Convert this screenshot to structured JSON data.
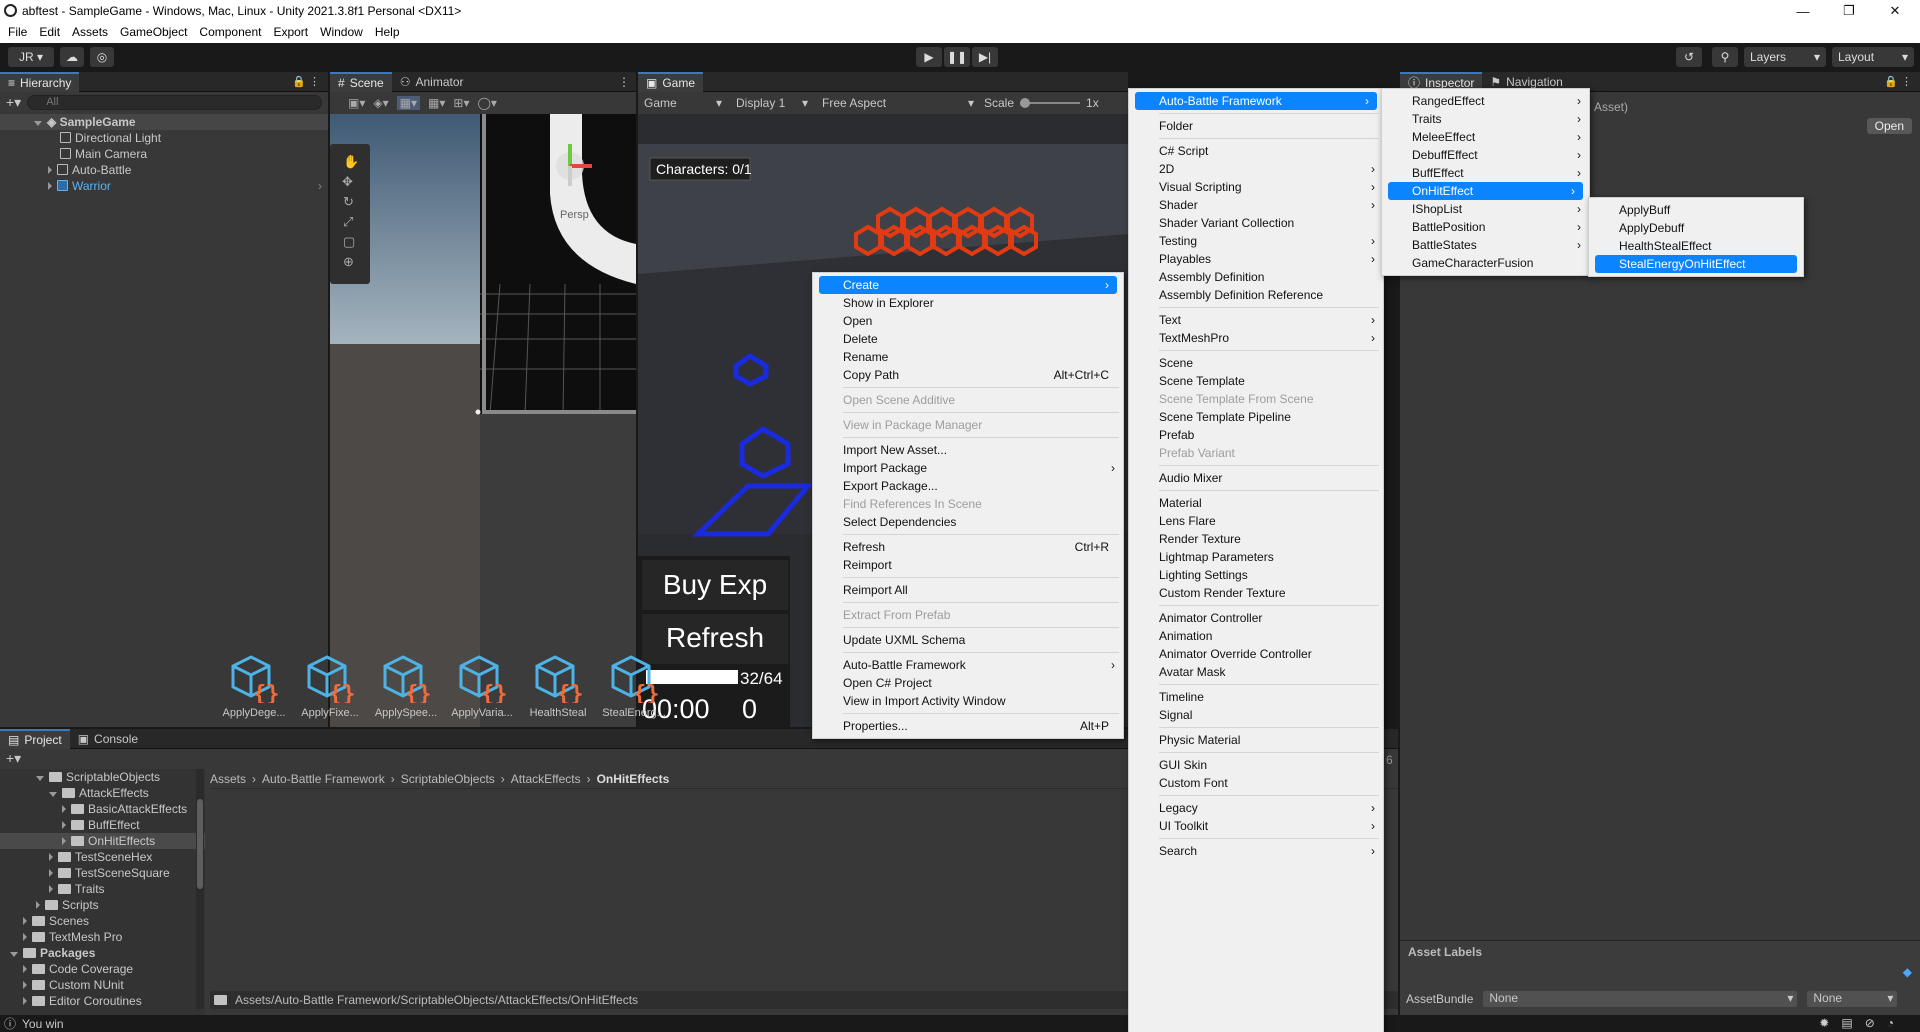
{
  "window": {
    "title": "abftest - SampleGame - Windows, Mac, Linux - Unity 2021.3.8f1 Personal <DX11>",
    "minimize": "—",
    "maximize": "❐",
    "close": "✕"
  },
  "menubar": [
    "File",
    "Edit",
    "Assets",
    "GameObject",
    "Component",
    "Export",
    "Window",
    "Help"
  ],
  "toolbar": {
    "account": "JR ▾",
    "layers": "Layers",
    "layout": "Layout"
  },
  "hierarchy": {
    "tab": "Hierarchy",
    "search_placeholder": "All",
    "scene": "SampleGame",
    "items": [
      "Directional Light",
      "Main Camera",
      "Auto-Battle",
      "Warrior"
    ]
  },
  "scene": {
    "tab_scene": "Scene",
    "tab_animator": "Animator",
    "persp_label": "Persp"
  },
  "game": {
    "tab": "Game",
    "display_mode": "Game",
    "display": "Display 1",
    "aspect": "Free Aspect",
    "scale_label": "Scale",
    "scale_value": "1x",
    "characters": "Characters: 0/1",
    "buy_exp": "Buy Exp",
    "refresh": "Refresh",
    "exp": "32/64",
    "timer": "00:00",
    "gold": "0"
  },
  "inspector": {
    "tab": "Inspector",
    "tab_nav": "Navigation",
    "asset_suffix": "Asset)",
    "open_button": "Open",
    "asset_labels": "Asset Labels",
    "asset_bundle": "AssetBundle",
    "bundle_value": "None",
    "variant_value": "None"
  },
  "project": {
    "tab_project": "Project",
    "tab_console": "Console",
    "tree": [
      {
        "label": "ScriptableObjects",
        "indent": 2,
        "open": true
      },
      {
        "label": "AttackEffects",
        "indent": 3,
        "open": true
      },
      {
        "label": "BasicAttackEffects",
        "indent": 4,
        "open": false
      },
      {
        "label": "BuffEffect",
        "indent": 4,
        "open": false
      },
      {
        "label": "OnHitEffects",
        "indent": 4,
        "open": false
      },
      {
        "label": "TestSceneHex",
        "indent": 3,
        "open": false
      },
      {
        "label": "TestSceneSquare",
        "indent": 3,
        "open": false
      },
      {
        "label": "Traits",
        "indent": 3,
        "open": false
      },
      {
        "label": "Scripts",
        "indent": 2,
        "open": false
      },
      {
        "label": "Scenes",
        "indent": 1,
        "open": false
      },
      {
        "label": "TextMesh Pro",
        "indent": 1,
        "open": false
      },
      {
        "label": "Packages",
        "indent": 0,
        "open": true
      },
      {
        "label": "Code Coverage",
        "indent": 1,
        "open": false
      },
      {
        "label": "Custom NUnit",
        "indent": 1,
        "open": false
      },
      {
        "label": "Editor Coroutines",
        "indent": 1,
        "open": false
      }
    ],
    "breadcrumb": [
      "Assets",
      "Auto-Battle Framework",
      "ScriptableObjects",
      "AttackEffects",
      "OnHitEffects"
    ],
    "assets": [
      "ApplyDege...",
      "ApplyFixe...",
      "ApplySpee...",
      "ApplyVaria...",
      "HealthSteal",
      "StealEnerg..."
    ],
    "path": "Assets/Auto-Battle Framework/ScriptableObjects/AttackEffects/OnHitEffects",
    "count": "6"
  },
  "status": {
    "text": "You win"
  },
  "context_menu": [
    {
      "label": "Create",
      "arrow": true,
      "selected": true
    },
    {
      "label": "Show in Explorer"
    },
    {
      "label": "Open"
    },
    {
      "label": "Delete"
    },
    {
      "label": "Rename"
    },
    {
      "label": "Copy Path",
      "shortcut": "Alt+Ctrl+C"
    },
    {
      "sep": true
    },
    {
      "label": "Open Scene Additive",
      "disabled": true
    },
    {
      "sep": true
    },
    {
      "label": "View in Package Manager",
      "disabled": true
    },
    {
      "sep": true
    },
    {
      "label": "Import New Asset..."
    },
    {
      "label": "Import Package",
      "arrow": true
    },
    {
      "label": "Export Package..."
    },
    {
      "label": "Find References In Scene",
      "disabled": true
    },
    {
      "label": "Select Dependencies"
    },
    {
      "sep": true
    },
    {
      "label": "Refresh",
      "shortcut": "Ctrl+R"
    },
    {
      "label": "Reimport"
    },
    {
      "sep": true
    },
    {
      "label": "Reimport All"
    },
    {
      "sep": true
    },
    {
      "label": "Extract From Prefab",
      "disabled": true
    },
    {
      "sep": true
    },
    {
      "label": "Update UXML Schema"
    },
    {
      "sep": true
    },
    {
      "label": "Auto-Battle Framework",
      "arrow": true
    },
    {
      "label": "Open C# Project"
    },
    {
      "label": "View in Import Activity Window"
    },
    {
      "sep": true
    },
    {
      "label": "Properties...",
      "shortcut": "Alt+P"
    }
  ],
  "create_menu": [
    {
      "label": "Auto-Battle Framework",
      "arrow": true,
      "selected": true
    },
    {
      "sep": true
    },
    {
      "label": "Folder"
    },
    {
      "sep": true
    },
    {
      "label": "C# Script"
    },
    {
      "label": "2D",
      "arrow": true
    },
    {
      "label": "Visual Scripting",
      "arrow": true
    },
    {
      "label": "Shader",
      "arrow": true
    },
    {
      "label": "Shader Variant Collection"
    },
    {
      "label": "Testing",
      "arrow": true
    },
    {
      "label": "Playables",
      "arrow": true
    },
    {
      "label": "Assembly Definition"
    },
    {
      "label": "Assembly Definition Reference"
    },
    {
      "sep": true
    },
    {
      "label": "Text",
      "arrow": true
    },
    {
      "label": "TextMeshPro",
      "arrow": true
    },
    {
      "sep": true
    },
    {
      "label": "Scene"
    },
    {
      "label": "Scene Template"
    },
    {
      "label": "Scene Template From Scene",
      "disabled": true
    },
    {
      "label": "Scene Template Pipeline"
    },
    {
      "label": "Prefab"
    },
    {
      "label": "Prefab Variant",
      "disabled": true
    },
    {
      "sep": true
    },
    {
      "label": "Audio Mixer"
    },
    {
      "sep": true
    },
    {
      "label": "Material"
    },
    {
      "label": "Lens Flare"
    },
    {
      "label": "Render Texture"
    },
    {
      "label": "Lightmap Parameters"
    },
    {
      "label": "Lighting Settings"
    },
    {
      "label": "Custom Render Texture"
    },
    {
      "sep": true
    },
    {
      "label": "Animator Controller"
    },
    {
      "label": "Animation"
    },
    {
      "label": "Animator Override Controller"
    },
    {
      "label": "Avatar Mask"
    },
    {
      "sep": true
    },
    {
      "label": "Timeline"
    },
    {
      "label": "Signal"
    },
    {
      "sep": true
    },
    {
      "label": "Physic Material"
    },
    {
      "sep": true
    },
    {
      "label": "GUI Skin"
    },
    {
      "label": "Custom Font"
    },
    {
      "sep": true
    },
    {
      "label": "Legacy",
      "arrow": true
    },
    {
      "label": "UI Toolkit",
      "arrow": true
    },
    {
      "sep": true
    },
    {
      "label": "Search",
      "arrow": true
    }
  ],
  "abf_menu": [
    {
      "label": "RangedEffect",
      "arrow": true
    },
    {
      "label": "Traits",
      "arrow": true
    },
    {
      "label": "MeleeEffect",
      "arrow": true
    },
    {
      "label": "DebuffEffect",
      "arrow": true
    },
    {
      "label": "BuffEffect",
      "arrow": true
    },
    {
      "label": "OnHitEffect",
      "arrow": true,
      "selected": true
    },
    {
      "label": "IShopList",
      "arrow": true
    },
    {
      "label": "BattlePosition",
      "arrow": true
    },
    {
      "label": "BattleStates",
      "arrow": true
    },
    {
      "label": "GameCharacterFusion"
    }
  ],
  "onhit_menu": [
    {
      "label": "ApplyBuff"
    },
    {
      "label": "ApplyDebuff"
    },
    {
      "label": "HealthStealEffect"
    },
    {
      "label": "StealEnergyOnHitEffect",
      "selected": true
    }
  ],
  "colors": {
    "accent": "#0a84ff",
    "asset_icon": "#4db3e6",
    "asset_brace": "#f26b3a",
    "hex": "#e23a12",
    "blue_tile": "#1a2adf",
    "teal": "#25c3b8"
  }
}
